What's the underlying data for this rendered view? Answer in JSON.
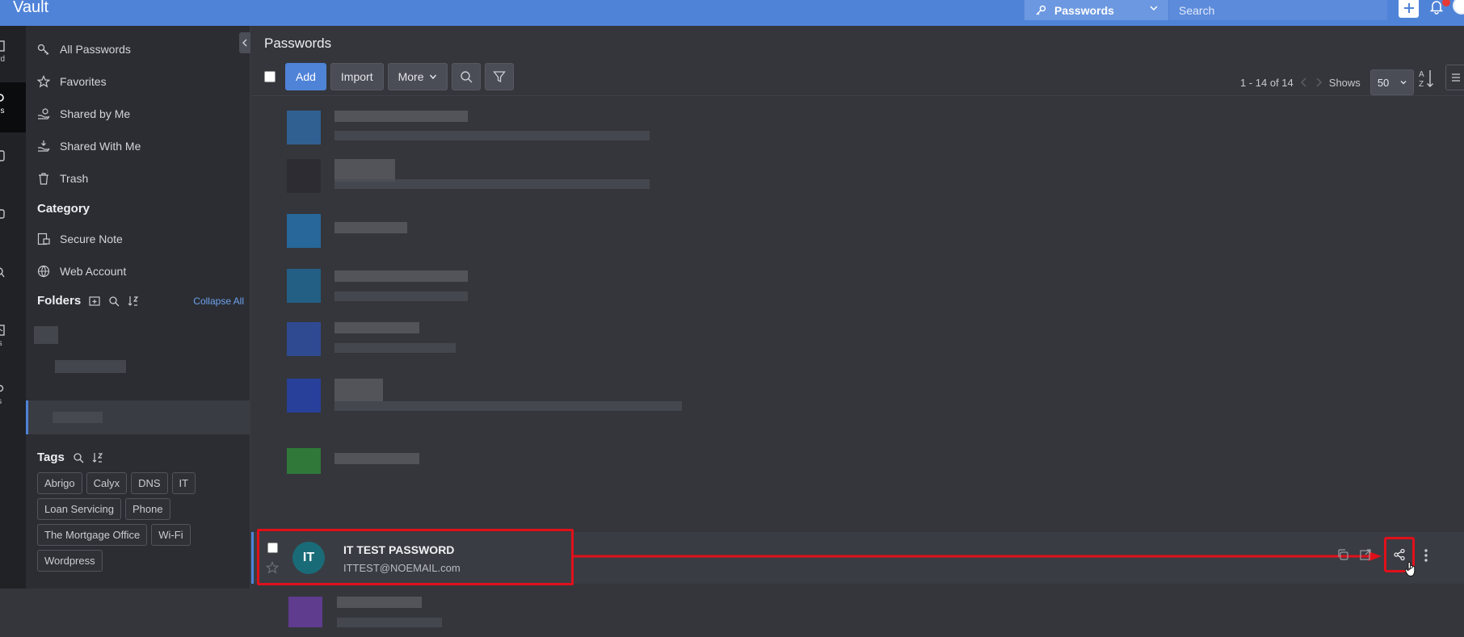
{
  "app": {
    "title": "Vault"
  },
  "topbar": {
    "scope_label": "Passwords",
    "search_placeholder": "Search",
    "colors": {
      "bar": "#4f83d8"
    }
  },
  "rail": {
    "items": [
      {
        "label": "oard",
        "active": false
      },
      {
        "label": "ords",
        "active": true
      },
      {
        "label": "ers",
        "active": false
      },
      {
        "label": "ps",
        "active": false
      },
      {
        "label": "dit",
        "active": false
      },
      {
        "label": "orts",
        "active": false
      },
      {
        "label": "ngs",
        "active": false
      }
    ]
  },
  "sidebar": {
    "nav": [
      {
        "label": "All Passwords",
        "icon": "key-icon"
      },
      {
        "label": "Favorites",
        "icon": "star-icon"
      },
      {
        "label": "Shared by Me",
        "icon": "share-hand-icon"
      },
      {
        "label": "Shared With Me",
        "icon": "receive-hand-icon"
      },
      {
        "label": "Trash",
        "icon": "trash-icon"
      }
    ],
    "category_title": "Category",
    "categories": [
      {
        "label": "Secure Note",
        "icon": "note-lock-icon"
      },
      {
        "label": "Web Account",
        "icon": "globe-icon"
      }
    ],
    "folders_title": "Folders",
    "collapse_all": "Collapse All",
    "tags_title": "Tags",
    "tags": [
      "Abrigo",
      "Calyx",
      "DNS",
      "IT",
      "Loan Servicing",
      "Phone",
      "The Mortgage Office",
      "Wi-Fi",
      "Wordpress"
    ]
  },
  "main": {
    "title": "Passwords",
    "toolbar": {
      "add": "Add",
      "import": "Import",
      "more": "More"
    },
    "pager": {
      "range": "1 - 14 of 14",
      "shows_label": "Shows",
      "page_size": "50"
    },
    "selected_row": {
      "avatar": "IT",
      "name": "IT TEST PASSWORD",
      "username": "ITTEST@NOEMAIL.com"
    }
  }
}
